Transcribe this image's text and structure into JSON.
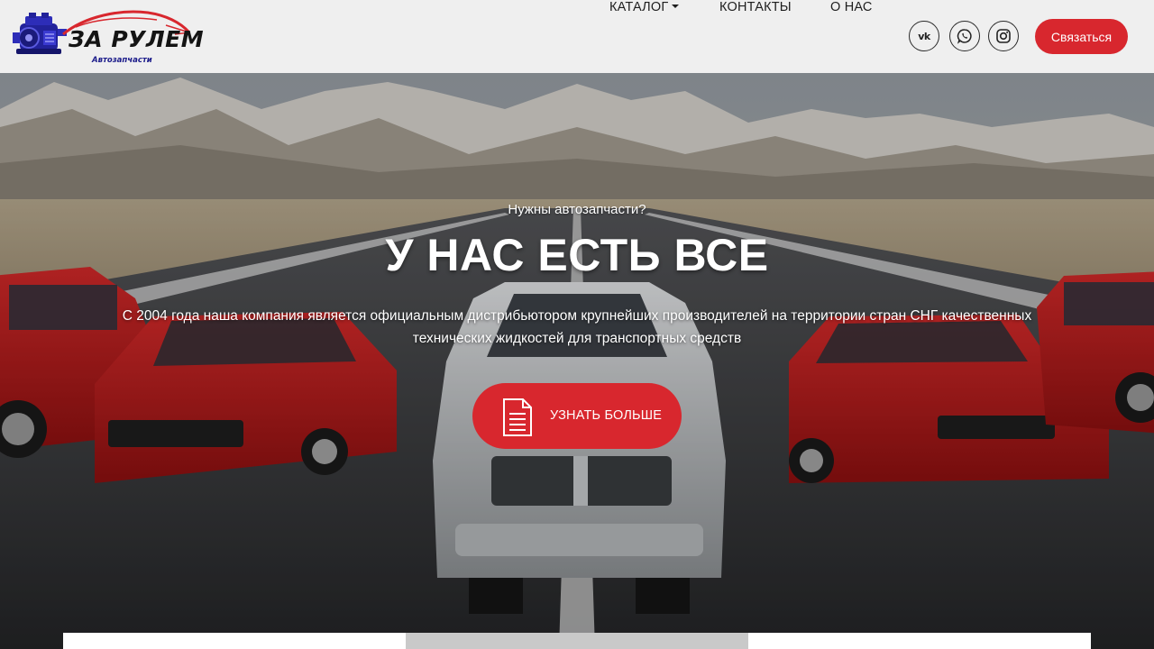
{
  "brand": {
    "name": "ЗА РУЛЕМ",
    "tagline": "Автозапчасти"
  },
  "nav": {
    "items": [
      {
        "label": "КАТАЛОГ",
        "has_dropdown": true
      },
      {
        "label": "КОНТАКТЫ",
        "has_dropdown": false
      },
      {
        "label": "О НАС",
        "has_dropdown": false
      }
    ]
  },
  "social": [
    {
      "name": "vk-icon",
      "text": "vk"
    },
    {
      "name": "whatsapp-icon"
    },
    {
      "name": "instagram-icon"
    }
  ],
  "header": {
    "cta_label": "Связаться"
  },
  "hero": {
    "pre_title": "Нужны автозапчасти?",
    "title": "У НАС ЕСТЬ ВСЕ",
    "description": "С 2004 года наша компания является официальным дистрибьютором крупнейших производителей на территории стран СНГ качественных технических жидкостей для транспортных средств",
    "button_label": "УЗНАТЬ БОЛЬШЕ"
  },
  "colors": {
    "accent": "#d8272e",
    "header_bg": "#efefef",
    "brand_blue": "#1b1b8a"
  }
}
